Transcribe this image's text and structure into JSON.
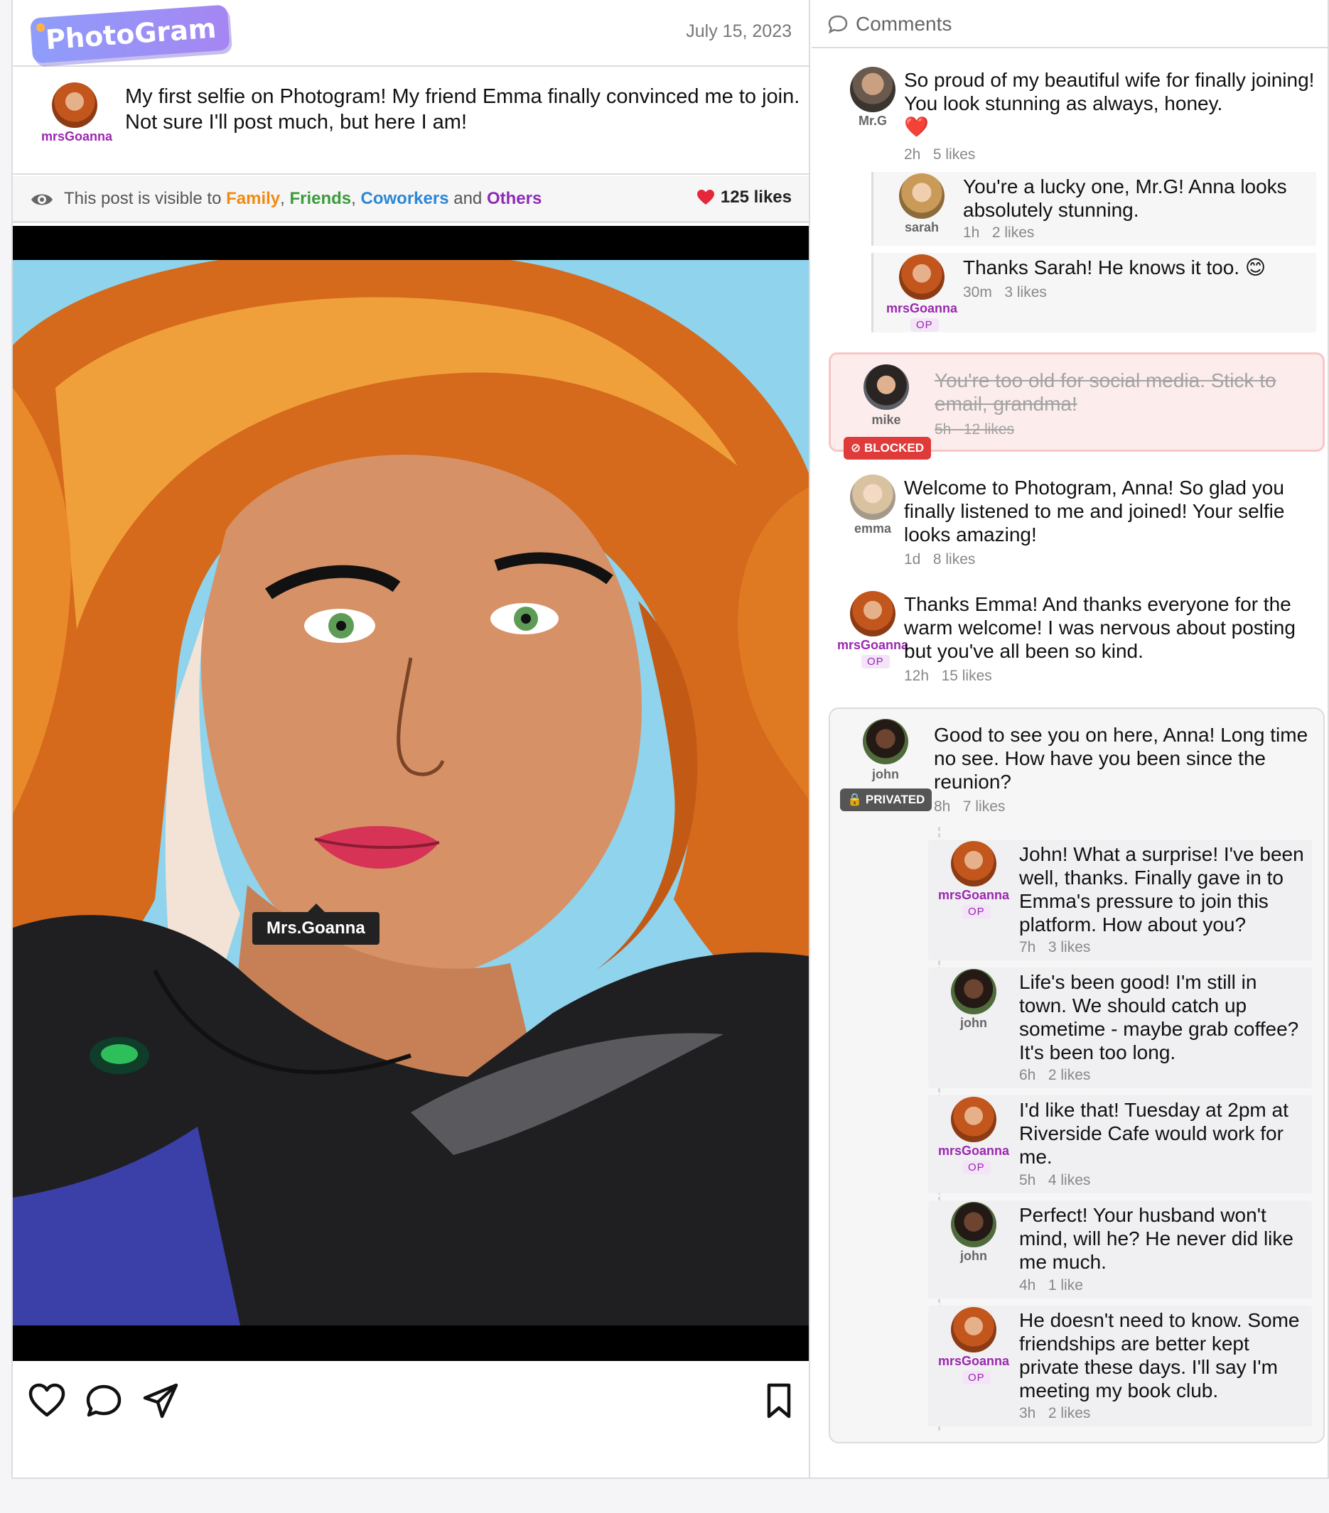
{
  "app": {
    "name": "PhotoGram"
  },
  "post": {
    "date": "July 15, 2023",
    "author": "mrsGoanna",
    "caption": "My first selfie on Photogram! My friend Emma finally convinced me to join. Not sure I'll post much, but here I am!",
    "visibility": {
      "prefix": "This post is visible to",
      "family": "Family",
      "comma1": ",",
      "friends": "Friends",
      "comma2": ",",
      "coworkers": "Coworkers",
      "and": "and",
      "others": "Others"
    },
    "likes": "125 likes",
    "photo_tag": "Mrs.Goanna"
  },
  "actions": {
    "like_icon": "heart-icon",
    "comment_icon": "comment-icon",
    "share_icon": "send-icon",
    "save_icon": "bookmark-icon"
  },
  "colors": {
    "brand": "#9b8cf6",
    "op": "#9b27b0",
    "blocked": "#e03b3b",
    "family": "#f28a10",
    "friends": "#3a9b3a",
    "coworkers": "#2b86d6",
    "others": "#8e2bb5"
  },
  "comments": {
    "title": "Comments",
    "op_label": "OP",
    "blocked_label": "BLOCKED",
    "private_label": "PRIVATED",
    "c1": {
      "user": "Mr.G",
      "text": "So proud of my beautiful wife for finally joining! You look stunning as always, honey.",
      "emoji": "❤️",
      "time": "2h",
      "likes": "5 likes"
    },
    "c1r1": {
      "user": "sarah",
      "text": "You're a lucky one, Mr.G! Anna looks absolutely stunning.",
      "time": "1h",
      "likes": "2 likes"
    },
    "c1r2": {
      "user": "mrsGoanna",
      "text": "Thanks Sarah! He knows it too. 😊",
      "time": "30m",
      "likes": "3 likes"
    },
    "c2": {
      "user": "mike",
      "text": "You're too old for social media. Stick to email, grandma!",
      "time": "5h",
      "likes": "12 likes"
    },
    "c3": {
      "user": "emma",
      "text": "Welcome to Photogram, Anna! So glad you finally listened to me and joined! Your selfie looks amazing!",
      "time": "1d",
      "likes": "8 likes"
    },
    "c4": {
      "user": "mrsGoanna",
      "text": "Thanks Emma! And thanks everyone for the warm welcome! I was nervous about posting but you've all been so kind.",
      "time": "12h",
      "likes": "15 likes"
    },
    "c5": {
      "user": "john",
      "text": "Good to see you on here, Anna! Long time no see. How have you been since the reunion?",
      "time": "8h",
      "likes": "7 likes"
    },
    "c5r1": {
      "user": "mrsGoanna",
      "text": "John! What a surprise! I've been well, thanks. Finally gave in to Emma's pressure to join this platform. How about you?",
      "time": "7h",
      "likes": "3 likes"
    },
    "c5r2": {
      "user": "john",
      "text": "Life's been good! I'm still in town. We should catch up sometime - maybe grab coffee? It's been too long.",
      "time": "6h",
      "likes": "2 likes"
    },
    "c5r3": {
      "user": "mrsGoanna",
      "text": "I'd like that! Tuesday at 2pm at Riverside Cafe would work for me.",
      "time": "5h",
      "likes": "4 likes"
    },
    "c5r4": {
      "user": "john",
      "text": "Perfect! Your husband won't mind, will he? He never did like me much.",
      "time": "4h",
      "likes": "1 like"
    },
    "c5r5": {
      "user": "mrsGoanna",
      "text": "He doesn't need to know. Some friendships are better kept private these days. I'll say I'm meeting my book club.",
      "time": "3h",
      "likes": "2 likes"
    }
  }
}
